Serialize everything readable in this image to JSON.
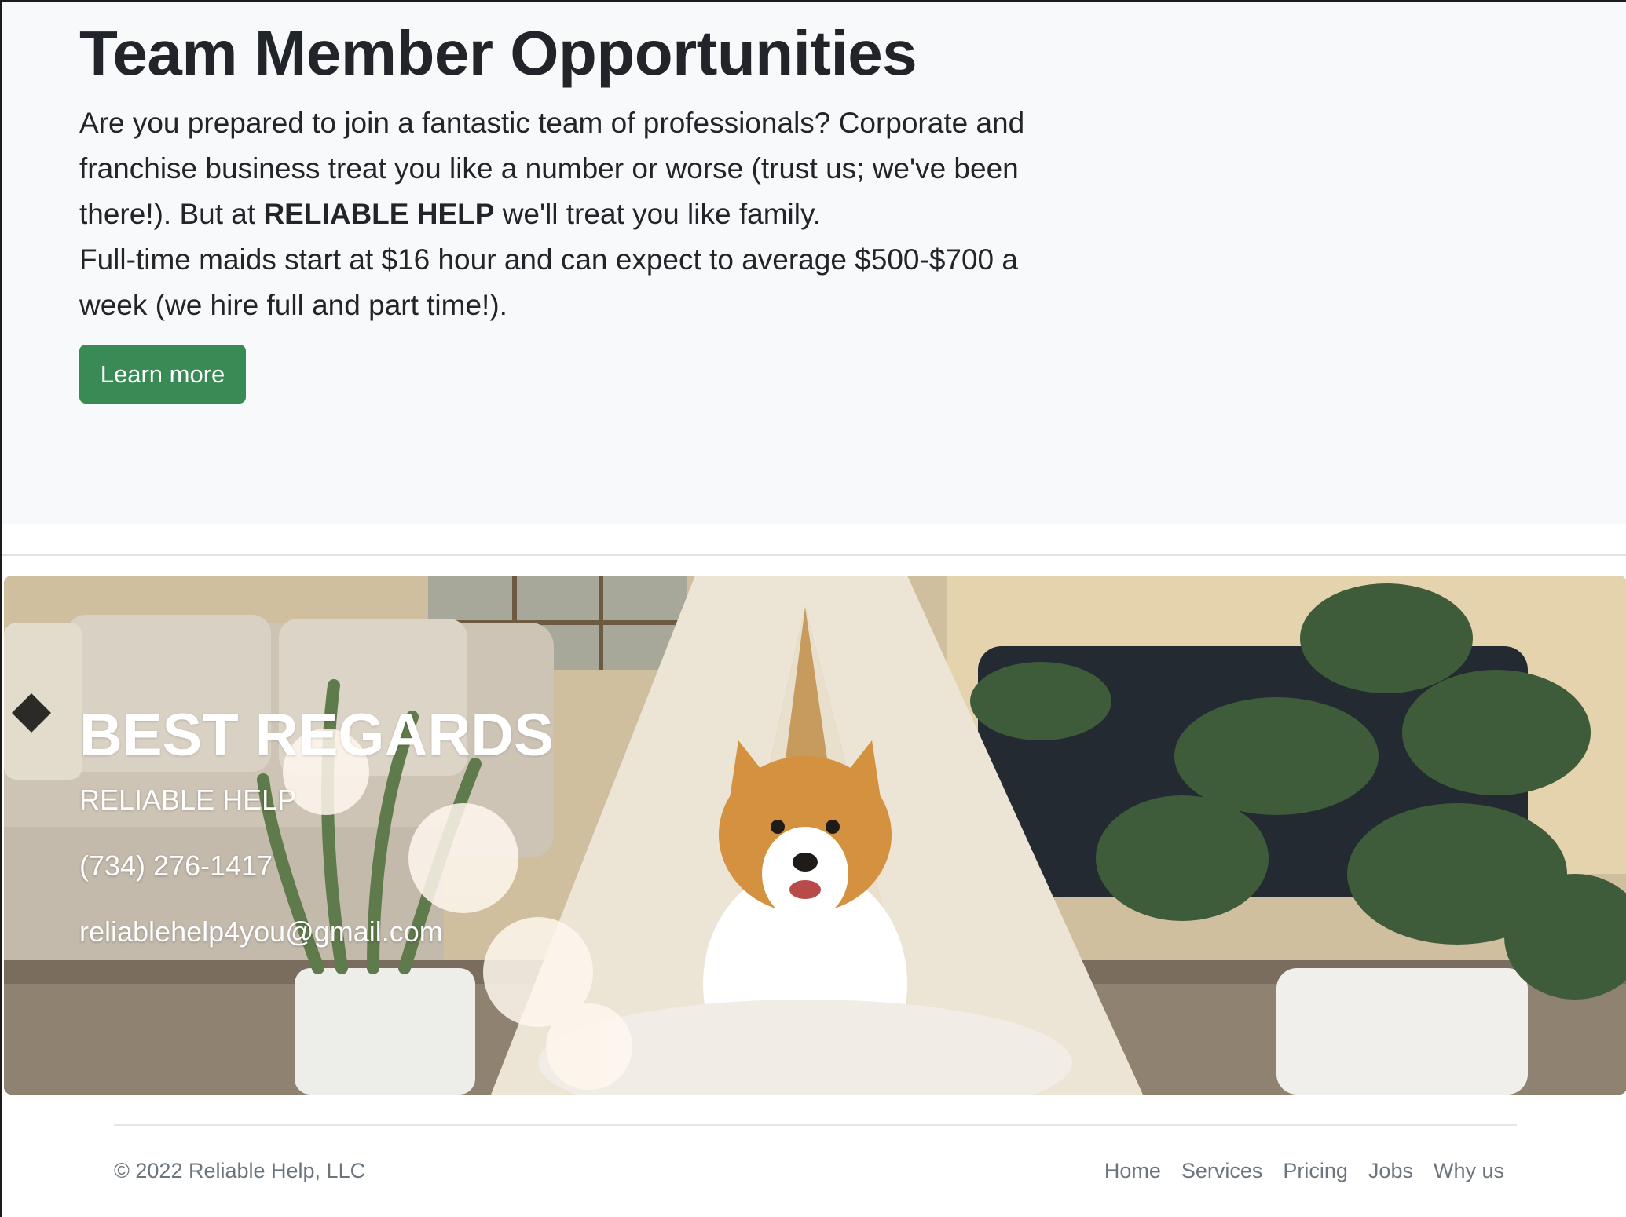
{
  "jobs": {
    "title": "Team Member Opportunities",
    "lead_part1": "Are you prepared to join a fantastic team of professionals? Corporate and franchise business treat you like a number or worse (trust us; we've been there!). But at ",
    "lead_bold": "RELIABLE HELP",
    "lead_part2": " we'll treat you like family.",
    "lead_line2": "Full-time maids start at $16 hour and can expect to average $500-$700 a week (we hire full and part time!).",
    "button_label": "Learn more"
  },
  "regards": {
    "title": "BEST REGARDS",
    "company": "RELIABLE HELP",
    "phone": "(734) 276-1417",
    "email": "reliablehelp4you@gmail.com"
  },
  "footer": {
    "copyright": "© 2022 Reliable Help, LLC",
    "nav": [
      "Home",
      "Services",
      "Pricing",
      "Jobs",
      "Why us"
    ]
  },
  "colors": {
    "accent": "#3a8a56",
    "section_bg": "#f8f9fa",
    "text": "#212529",
    "muted": "#6c757d"
  }
}
